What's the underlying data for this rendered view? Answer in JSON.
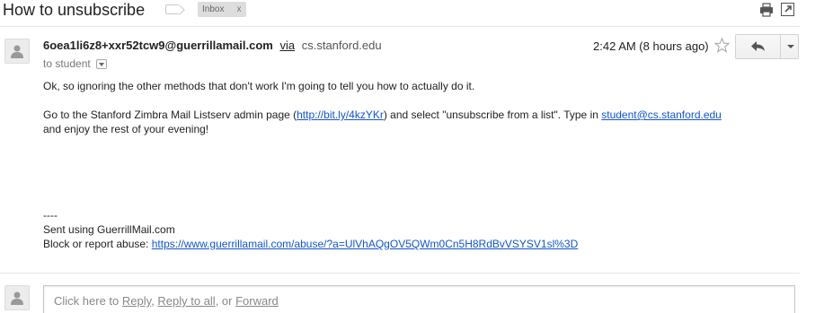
{
  "header": {
    "subject": "How to unsubscribe",
    "label": "Inbox",
    "label_remove": "x",
    "icons": {
      "important": "important-marker-icon",
      "print": "print-icon",
      "new_window": "new-window-icon"
    }
  },
  "message": {
    "sender_email": "6oea1li6z8+xxr52tcw9@guerrillamail.com",
    "via_label": "via",
    "via_domain": "cs.stanford.edu",
    "to_text": "to student",
    "date": "2:42 AM (8 hours ago)",
    "body": {
      "line1": "Ok, so ignoring the other methods that don't work I'm going to tell you how to actually do it.",
      "line2_prefix": "Go to the Stanford Zimbra Mail Listserv admin page (",
      "line2_link": "http://bit.ly/4kzYKr",
      "line2_middle": ") and select \"unsubscribe from a list\". Type in ",
      "line2_email": "student@cs.stanford.edu",
      "line3": "and enjoy the rest of your evening!"
    },
    "signature": {
      "separator": "----",
      "sent_using": "Sent using GuerrillMail.com",
      "abuse_prefix": "Block or report abuse: ",
      "abuse_link": "https://www.guerrillamail.com/abuse/?a=UlVhAQgOV5QWm0Cn5H8RdBvVSYSV1sl%3D"
    }
  },
  "reply_box": {
    "prefix": "Click here to ",
    "reply": "Reply",
    "sep1": ", ",
    "reply_all": "Reply to all",
    "sep2": ", or ",
    "forward": "Forward"
  }
}
